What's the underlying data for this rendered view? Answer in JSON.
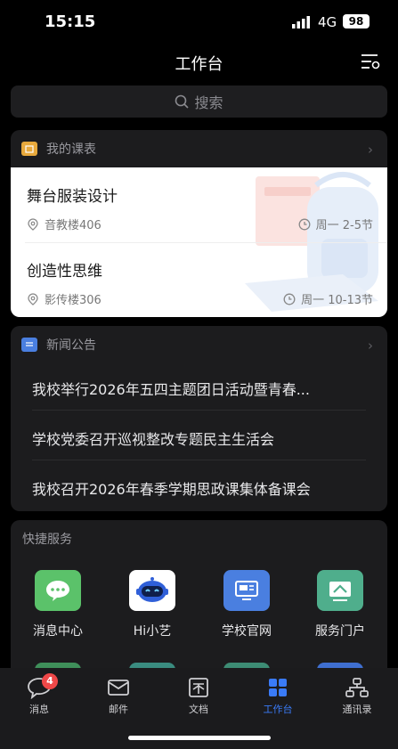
{
  "status_bar": {
    "time": "15:15",
    "network": "4G",
    "battery": "98"
  },
  "header": {
    "title": "工作台",
    "search_placeholder": "搜索"
  },
  "schedule": {
    "title": "我的课表",
    "courses": [
      {
        "name": "舞台服装设计",
        "location": "音教楼406",
        "time": "周一 2-5节"
      },
      {
        "name": "创造性思维",
        "location": "影传楼306",
        "time": "周一 10-13节"
      }
    ]
  },
  "news": {
    "title": "新闻公告",
    "items": [
      "我校举行2026年五四主题团日活动暨青春...",
      "学校党委召开巡视整改专题民主生活会",
      "我校召开2026年春季学期思政课集体备课会"
    ]
  },
  "quick_services": {
    "title": "快捷服务",
    "items": [
      {
        "label": "消息中心",
        "icon": "chat-bubble-icon",
        "color": "#5bc26a"
      },
      {
        "label": "Hi小艺",
        "icon": "robot-icon",
        "color": "#ffffff"
      },
      {
        "label": "学校官网",
        "icon": "monitor-icon",
        "color": "#4a7fe0"
      },
      {
        "label": "服务门户",
        "icon": "portal-icon",
        "color": "#4fae8c"
      }
    ]
  },
  "tab_bar": {
    "tabs": [
      {
        "label": "消息",
        "icon": "chat-icon",
        "badge": "4"
      },
      {
        "label": "邮件",
        "icon": "mail-icon"
      },
      {
        "label": "文档",
        "icon": "document-icon"
      },
      {
        "label": "工作台",
        "icon": "workbench-icon",
        "active": true
      },
      {
        "label": "通讯录",
        "icon": "contacts-icon"
      }
    ]
  },
  "colors": {
    "accent": "#3a7bf7",
    "badge": "#f04848",
    "schedule_icon": "#e8a93c",
    "news_icon": "#4a7fe0"
  }
}
